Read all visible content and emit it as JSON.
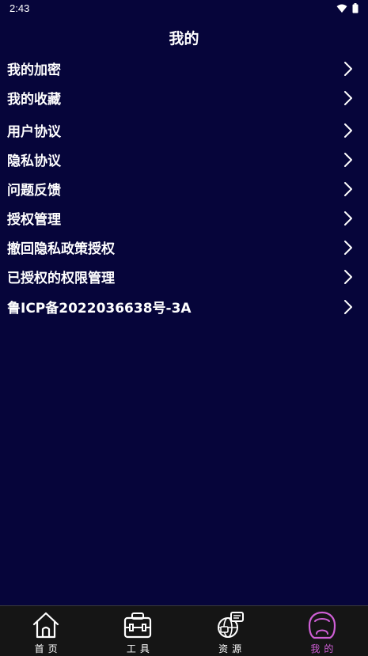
{
  "status_bar": {
    "time": "2:43"
  },
  "header": {
    "title": "我的"
  },
  "menu": {
    "items": [
      {
        "label": "我的加密"
      },
      {
        "label": "我的收藏"
      },
      {
        "label": "用户协议"
      },
      {
        "label": "隐私协议"
      },
      {
        "label": "问题反馈"
      },
      {
        "label": "授权管理"
      },
      {
        "label": "撤回隐私政策授权"
      },
      {
        "label": "已授权的权限管理"
      },
      {
        "label": "鲁ICP备2022036638号-3A"
      }
    ]
  },
  "tab_bar": {
    "tabs": [
      {
        "label": "首页",
        "icon": "home-icon"
      },
      {
        "label": "工具",
        "icon": "toolbox-icon"
      },
      {
        "label": "资源",
        "icon": "globe-chat-icon"
      },
      {
        "label": "我的",
        "icon": "profile-icon",
        "active": true
      }
    ],
    "active_color": "#cf5fd6"
  },
  "colors": {
    "background": "#06053a",
    "tab_bar_background": "#151515",
    "text": "#ffffff"
  }
}
